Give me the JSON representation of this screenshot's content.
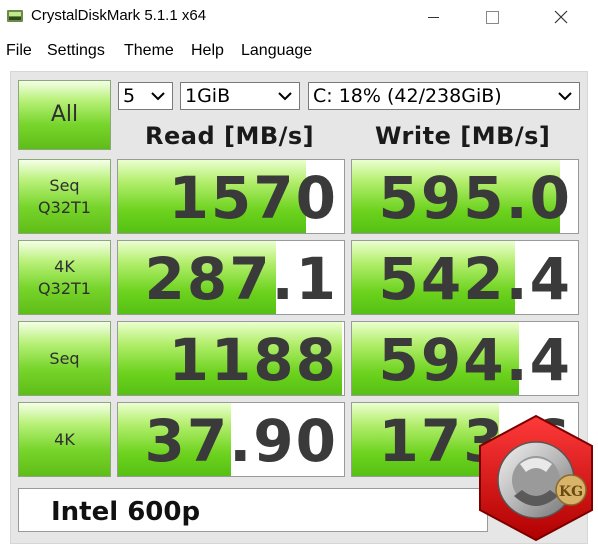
{
  "window": {
    "title": "CrystalDiskMark 5.1.1 x64",
    "minimize_icon": "minimize-icon",
    "maximize_icon": "maximize-icon",
    "close_icon": "close-icon"
  },
  "menu": [
    "File",
    "Settings",
    "Theme",
    "Help",
    "Language"
  ],
  "controls": {
    "all_label": "All",
    "count": "5",
    "size": "1GiB",
    "drive": "C: 18% (42/238GiB)"
  },
  "headers": {
    "read": "Read [MB/s]",
    "write": "Write [MB/s]"
  },
  "tests": [
    {
      "label": "Seq\nQ32T1",
      "read": "1570",
      "write": "595.0",
      "read_fill": 0.83,
      "write_fill": 0.92
    },
    {
      "label": "4K\nQ32T1",
      "read": "287.1",
      "write": "542.4",
      "read_fill": 0.7,
      "write_fill": 0.72
    },
    {
      "label": "Seq",
      "read": "1188",
      "write": "594.4",
      "read_fill": 0.99,
      "write_fill": 0.74
    },
    {
      "label": "4K",
      "read": "37.90",
      "write": "173.6",
      "read_fill": 0.5,
      "write_fill": 0.65
    }
  ],
  "comment": "Intel 600p",
  "watermark": {
    "text": "KG",
    "icon": "kitguru-logo-icon"
  },
  "colors": {
    "green": "#6cd21d",
    "panel": "#e6e6e6",
    "value_text": "#3a3a3a"
  }
}
